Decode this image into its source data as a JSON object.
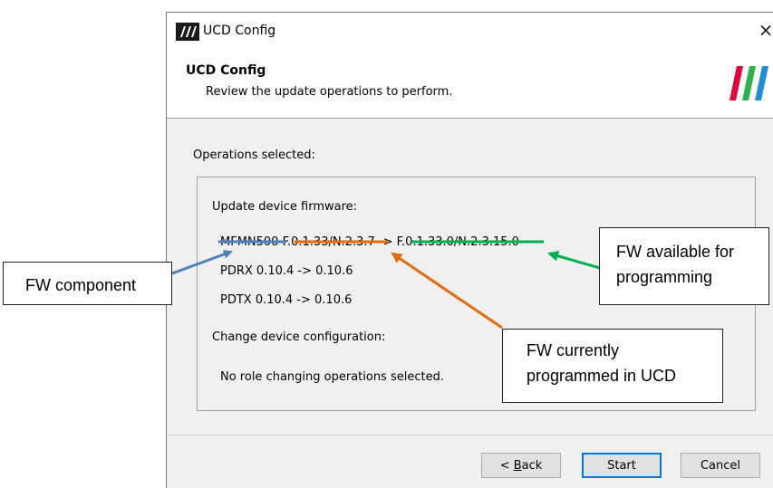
{
  "window": {
    "title": "UCD Config",
    "close_glyph": "×"
  },
  "header": {
    "title": "UCD Config",
    "subtitle": "Review the update operations to perform."
  },
  "operations": {
    "label": "Operations selected:",
    "firmware_section_title": "Update device firmware:",
    "firmware_lines": [
      {
        "component": "MFMN500",
        "current": "F.0.1.33/N.2.3.7",
        "arrow": "->",
        "available": "F.0.1.33.0/N.2.3.15.0"
      },
      {
        "text": "PDRX 0.10.4 -> 0.10.6"
      },
      {
        "text": "PDTX 0.10.4 -> 0.10.6"
      }
    ],
    "config_section_title": "Change device configuration:",
    "config_message": "No role changing operations selected."
  },
  "buttons": {
    "back_prefix": "< ",
    "back_accel": "B",
    "back_rest": "ack",
    "start": "Start",
    "cancel": "Cancel"
  },
  "annotations": {
    "component": "FW component",
    "available_line1": "FW available for",
    "available_line2": "programming",
    "current_line1": "FW currently",
    "current_line2": "programmed in UCD"
  },
  "colors": {
    "component": "#4f81bd",
    "current": "#e36c0a",
    "available": "#00b050",
    "focus_border": "#0078d7"
  },
  "icons": [
    "app-logo-icon",
    "close-icon",
    "brand-logo-icon"
  ]
}
